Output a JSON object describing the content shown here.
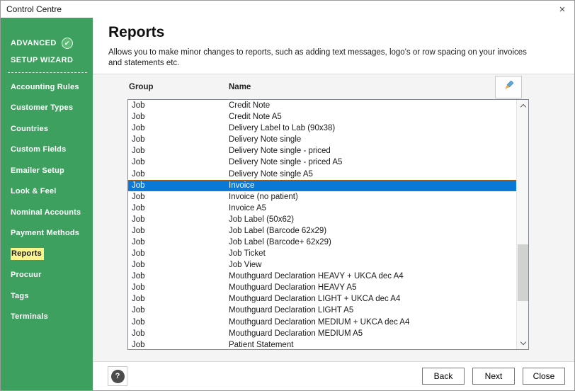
{
  "window": {
    "title": "Control Centre"
  },
  "icons": {
    "close": "×",
    "check": "✔",
    "help": "?"
  },
  "sidebar": {
    "advanced_label": "ADVANCED",
    "wizard_label": "SETUP WIZARD",
    "items": [
      {
        "label": "Accounting Rules",
        "active": false
      },
      {
        "label": "Customer Types",
        "active": false
      },
      {
        "label": "Countries",
        "active": false
      },
      {
        "label": "Custom Fields",
        "active": false
      },
      {
        "label": "Emailer Setup",
        "active": false
      },
      {
        "label": "Look & Feel",
        "active": false
      },
      {
        "label": "Nominal Accounts",
        "active": false
      },
      {
        "label": "Payment Methods",
        "active": false
      },
      {
        "label": "Reports",
        "active": true
      },
      {
        "label": "Procuur",
        "active": false
      },
      {
        "label": "Tags",
        "active": false
      },
      {
        "label": "Terminals",
        "active": false
      }
    ]
  },
  "main": {
    "title": "Reports",
    "description": "Allows you to make minor changes to reports, such as adding text messages, logo's or row spacing on your invoices and statements etc.",
    "columns": {
      "group": "Group",
      "name": "Name"
    },
    "rows": [
      {
        "group": "Job",
        "name": "Credit Note",
        "selected": false
      },
      {
        "group": "Job",
        "name": "Credit Note A5",
        "selected": false
      },
      {
        "group": "Job",
        "name": "Delivery Label to Lab (90x38)",
        "selected": false
      },
      {
        "group": "Job",
        "name": "Delivery Note single",
        "selected": false
      },
      {
        "group": "Job",
        "name": "Delivery Note single - priced",
        "selected": false
      },
      {
        "group": "Job",
        "name": "Delivery Note single - priced A5",
        "selected": false
      },
      {
        "group": "Job",
        "name": "Delivery Note single A5",
        "selected": false
      },
      {
        "group": "Job",
        "name": "Invoice",
        "selected": true
      },
      {
        "group": "Job",
        "name": "Invoice (no patient)",
        "selected": false
      },
      {
        "group": "Job",
        "name": "Invoice A5",
        "selected": false
      },
      {
        "group": "Job",
        "name": "Job Label (50x62)",
        "selected": false
      },
      {
        "group": "Job",
        "name": "Job Label (Barcode 62x29)",
        "selected": false
      },
      {
        "group": "Job",
        "name": "Job Label (Barcode+ 62x29)",
        "selected": false
      },
      {
        "group": "Job",
        "name": "Job Ticket",
        "selected": false
      },
      {
        "group": "Job",
        "name": "Job View",
        "selected": false
      },
      {
        "group": "Job",
        "name": "Mouthguard Declaration HEAVY + UKCA dec A4",
        "selected": false
      },
      {
        "group": "Job",
        "name": "Mouthguard Declaration HEAVY A5",
        "selected": false
      },
      {
        "group": "Job",
        "name": "Mouthguard Declaration LIGHT + UKCA dec A4",
        "selected": false
      },
      {
        "group": "Job",
        "name": "Mouthguard Declaration LIGHT A5",
        "selected": false
      },
      {
        "group": "Job",
        "name": "Mouthguard Declaration MEDIUM + UKCA dec A4",
        "selected": false
      },
      {
        "group": "Job",
        "name": "Mouthguard Declaration MEDIUM A5",
        "selected": false
      },
      {
        "group": "Job",
        "name": "Patient Statement",
        "selected": false
      }
    ]
  },
  "footer": {
    "back_label": "Back",
    "next_label": "Next",
    "close_label": "Close"
  },
  "colors": {
    "sidebar_green": "#3da05f",
    "check_badge_green": "#5cbc76",
    "highlight_yellow": "#faf48e",
    "selection_blue": "#0a78d7",
    "pencil_blue": "#58a8e0",
    "pencil_tip_orange": "#f2a73d"
  }
}
